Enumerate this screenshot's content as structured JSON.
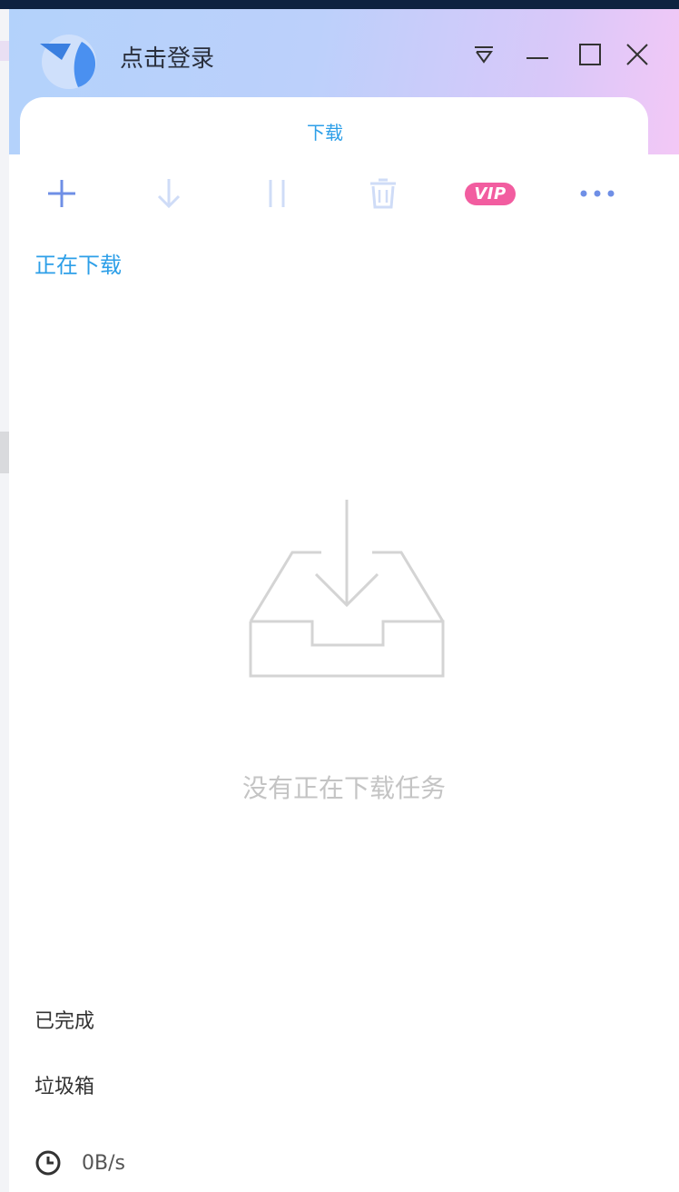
{
  "header": {
    "login_label": "点击登录",
    "tab_label": "下载"
  },
  "window_controls": {
    "menu_icon": "triangle-menu-icon",
    "minimize_icon": "minimize-icon",
    "maximize_icon": "maximize-icon",
    "close_icon": "close-icon"
  },
  "toolbar": {
    "add_icon": "plus-icon",
    "download_icon": "download-arrow-icon",
    "pause_icon": "pause-icon",
    "delete_icon": "trash-icon",
    "vip_label": "VIP",
    "more_icon": "more-dots-icon"
  },
  "sections": {
    "downloading": "正在下载",
    "completed": "已完成",
    "trash": "垃圾箱"
  },
  "empty_state": {
    "message": "没有正在下载任务",
    "icon": "inbox-download-icon"
  },
  "status": {
    "speed": "0B/s",
    "speed_icon": "clock-icon"
  },
  "colors": {
    "accent": "#2d9fe8",
    "toolbar_icon": "#6f8fe6",
    "toolbar_icon_disabled": "#cfdcf7",
    "vip": "#f25da0",
    "empty_text": "#c4c4c4"
  }
}
